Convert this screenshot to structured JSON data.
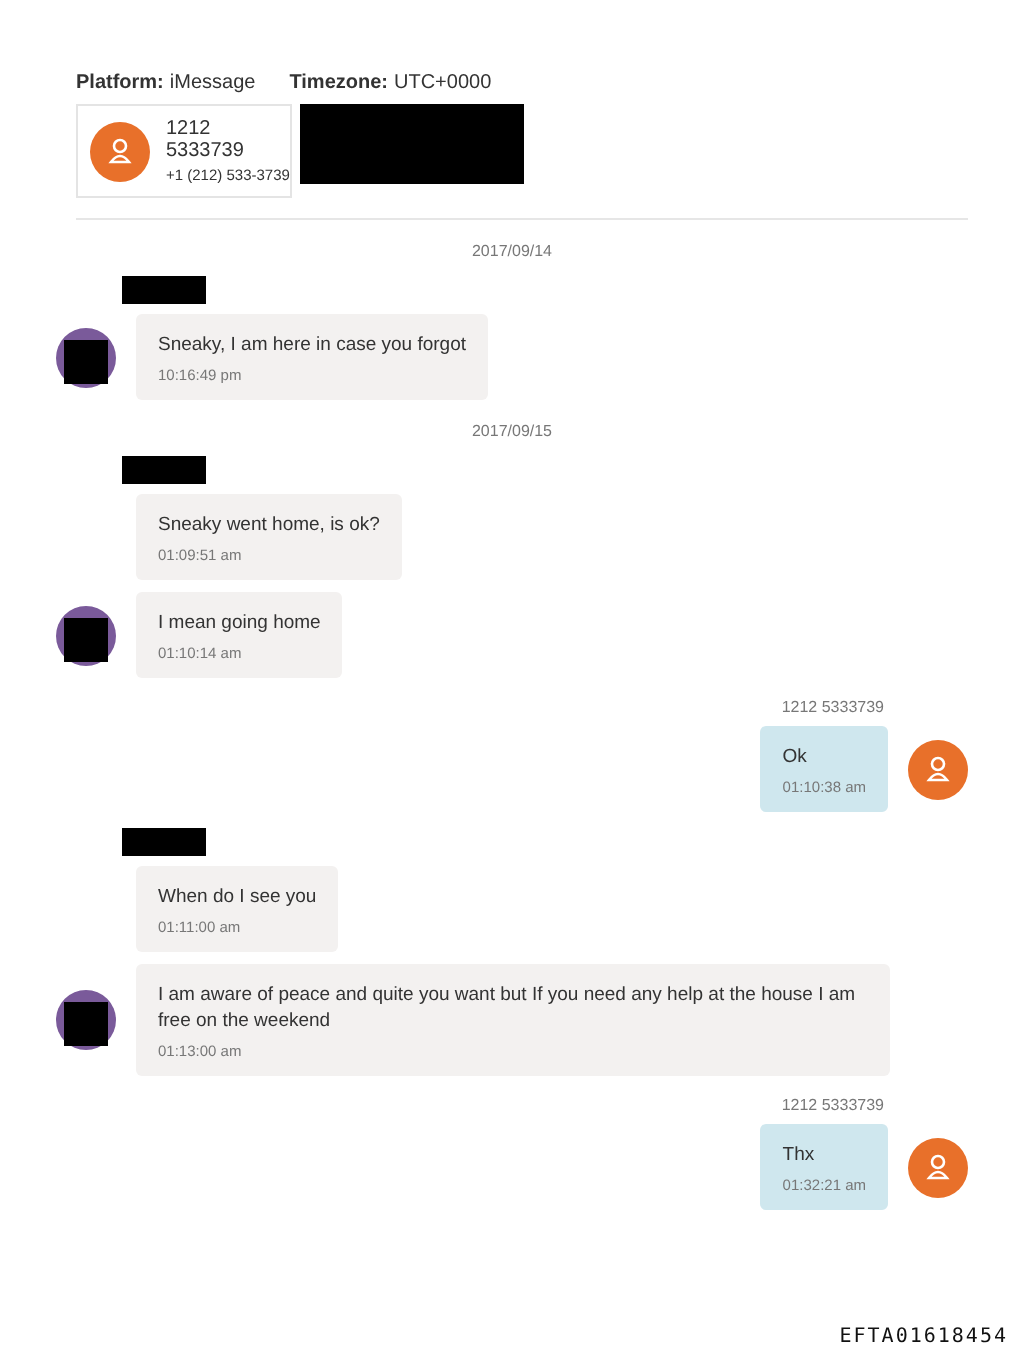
{
  "header": {
    "platform_label": "Platform:",
    "platform": "iMessage",
    "timezone_label": "Timezone:",
    "timezone": "UTC+0000",
    "contact": {
      "name": "1212 5333739",
      "phone": "+1 (212) 533-3739"
    }
  },
  "items": [
    {
      "kind": "date",
      "text": "2017/09/14"
    },
    {
      "kind": "incoming",
      "messages": [
        {
          "text": "Sneaky, I am here in case you forgot",
          "time": "10:16:49 pm"
        }
      ]
    },
    {
      "kind": "date",
      "text": "2017/09/15"
    },
    {
      "kind": "incoming",
      "messages": [
        {
          "text": "Sneaky went home, is ok?",
          "time": "01:09:51 am"
        },
        {
          "text": "I mean going home",
          "time": "01:10:14 am"
        }
      ]
    },
    {
      "kind": "outgoing",
      "sender": "1212 5333739",
      "messages": [
        {
          "text": "Ok",
          "time": "01:10:38 am"
        }
      ]
    },
    {
      "kind": "incoming",
      "messages": [
        {
          "text": "When do I see you",
          "time": "01:11:00 am"
        },
        {
          "text": "I am aware of peace and quite you want but If you need any help at the house I am free on the weekend",
          "time": "01:13:00 am"
        }
      ]
    },
    {
      "kind": "outgoing",
      "sender": "1212 5333739",
      "messages": [
        {
          "text": "Thx",
          "time": "01:32:21 am"
        }
      ]
    }
  ],
  "document_id": "EFTA01618454"
}
